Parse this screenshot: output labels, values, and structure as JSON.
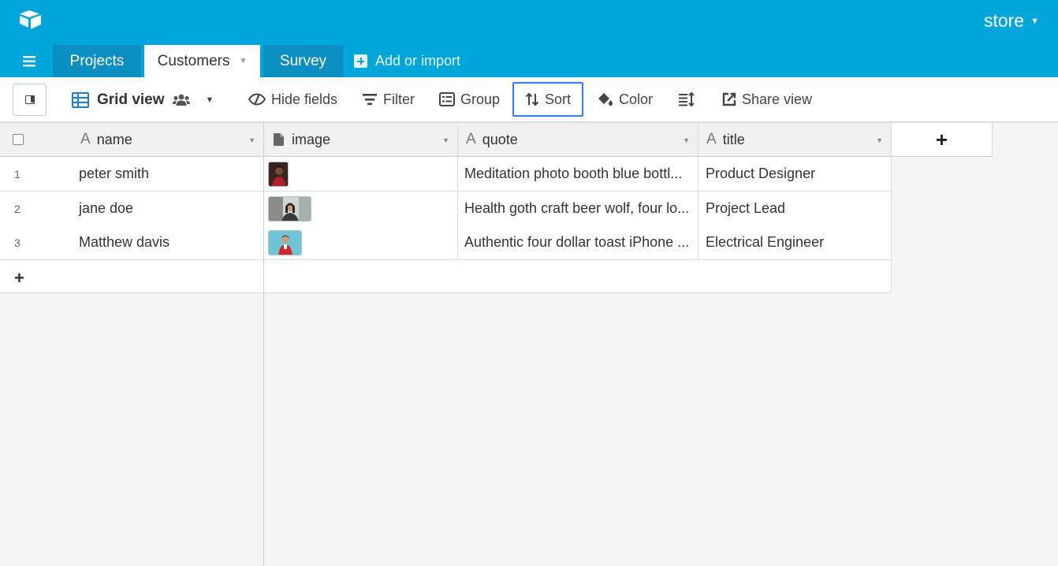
{
  "app": {
    "base_name": "store",
    "logo_icon": "airtable-logo-icon"
  },
  "colors": {
    "topbar": "#00a6d9",
    "inactive_tab": "#0b8fc0",
    "accent_blue": "#2d7ff9"
  },
  "tabs": [
    {
      "label": "Projects",
      "active": false
    },
    {
      "label": "Customers",
      "active": true
    },
    {
      "label": "Survey",
      "active": false
    }
  ],
  "add_import_label": "Add or import",
  "toolbar": {
    "view_name": "Grid view",
    "hide_fields": "Hide fields",
    "filter": "Filter",
    "group": "Group",
    "sort": "Sort",
    "color": "Color",
    "share_view": "Share view"
  },
  "columns": [
    {
      "name": "name",
      "type_icon": "text-field-icon"
    },
    {
      "name": "image",
      "type_icon": "attachment-field-icon"
    },
    {
      "name": "quote",
      "type_icon": "text-field-icon"
    },
    {
      "name": "title",
      "type_icon": "text-field-icon"
    }
  ],
  "rows": [
    {
      "num": "1",
      "name": "peter smith",
      "quote": "Meditation photo booth blue bottl...",
      "title": "Product Designer"
    },
    {
      "num": "2",
      "name": "jane doe",
      "quote": "Health goth craft beer wolf, four lo...",
      "title": "Project Lead"
    },
    {
      "num": "3",
      "name": "Matthew davis",
      "quote": "Authentic four dollar toast iPhone ...",
      "title": "Electrical Engineer"
    }
  ]
}
